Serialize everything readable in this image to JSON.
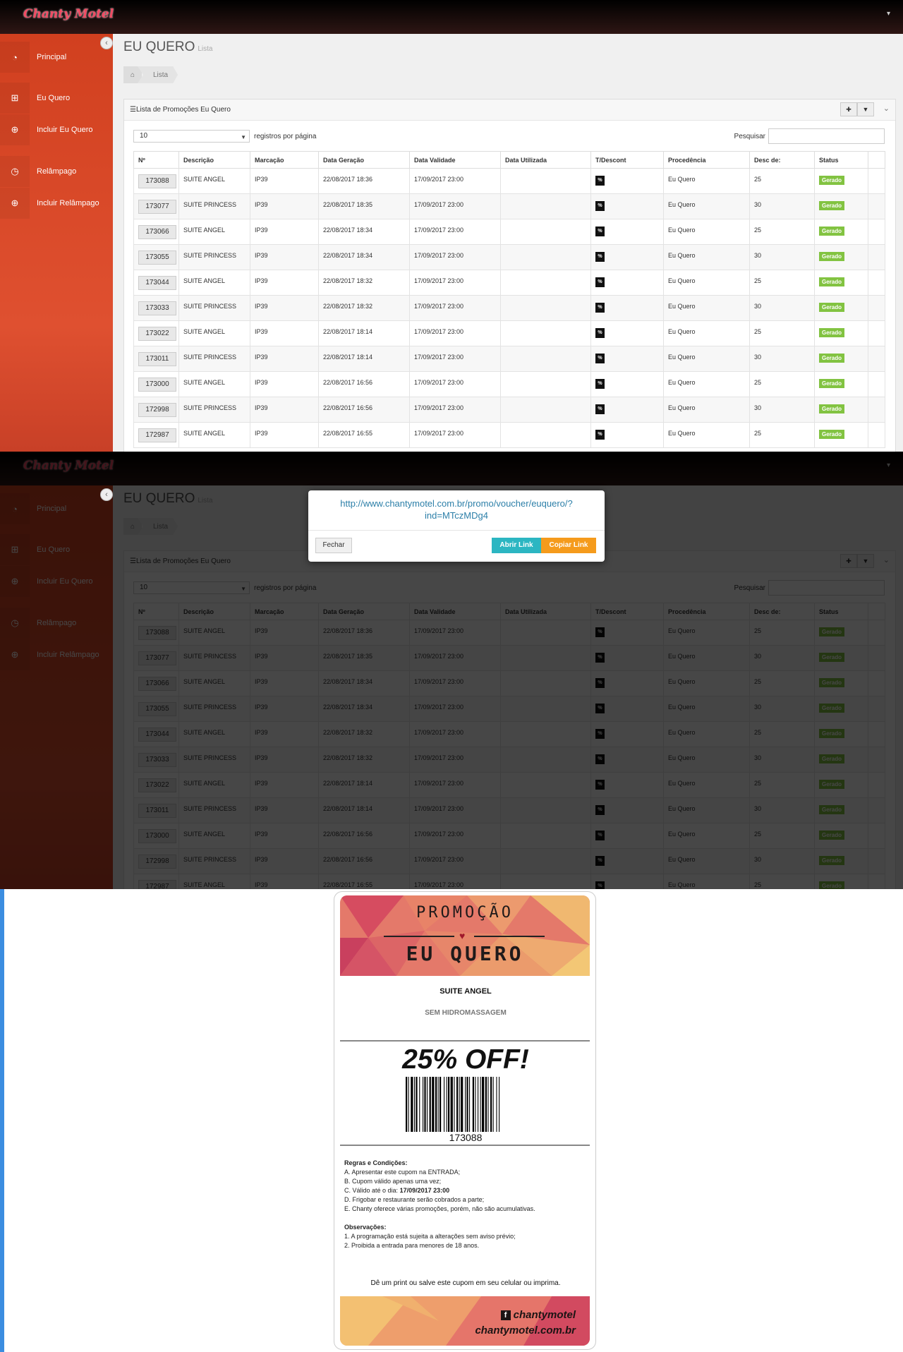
{
  "app": {
    "logo": "Chanty Motel",
    "page_title": "EU QUERO",
    "page_subtitle": "Lista",
    "breadcrumb": [
      "Lista"
    ],
    "sidebar": [
      {
        "label": "Principal",
        "icon": "dashboard-icon"
      },
      {
        "label": "Eu Quero",
        "icon": "gift-icon"
      },
      {
        "label": "Incluir Eu Quero",
        "icon": "plus-square-icon"
      },
      {
        "label": "Relâmpago",
        "icon": "clock-icon"
      },
      {
        "label": "Incluir Relâmpago",
        "icon": "plus-square-icon"
      }
    ],
    "panel_title": "Lista de Promoções Eu Quero",
    "length_value": "10",
    "length_label": "registros por página",
    "search_label": "Pesquisar",
    "columns": [
      "Nº",
      "Descrição",
      "Marcação",
      "Data Geração",
      "Data Validade",
      "Data Utilizada",
      "T/Descont",
      "Procedência",
      "Desc de:",
      "Status"
    ],
    "rows": [
      {
        "id": "173088",
        "desc": "SUITE ANGEL",
        "marc": "IP39",
        "gen": "22/08/2017 18:36",
        "val": "17/09/2017 23:00",
        "used": "",
        "tipo": "%",
        "proc": "Eu Quero",
        "pct": "25",
        "status": "Gerado"
      },
      {
        "id": "173077",
        "desc": "SUITE PRINCESS",
        "marc": "IP39",
        "gen": "22/08/2017 18:35",
        "val": "17/09/2017 23:00",
        "used": "",
        "tipo": "%",
        "proc": "Eu Quero",
        "pct": "30",
        "status": "Gerado"
      },
      {
        "id": "173066",
        "desc": "SUITE ANGEL",
        "marc": "IP39",
        "gen": "22/08/2017 18:34",
        "val": "17/09/2017 23:00",
        "used": "",
        "tipo": "%",
        "proc": "Eu Quero",
        "pct": "25",
        "status": "Gerado"
      },
      {
        "id": "173055",
        "desc": "SUITE PRINCESS",
        "marc": "IP39",
        "gen": "22/08/2017 18:34",
        "val": "17/09/2017 23:00",
        "used": "",
        "tipo": "%",
        "proc": "Eu Quero",
        "pct": "30",
        "status": "Gerado"
      },
      {
        "id": "173044",
        "desc": "SUITE ANGEL",
        "marc": "IP39",
        "gen": "22/08/2017 18:32",
        "val": "17/09/2017 23:00",
        "used": "",
        "tipo": "%",
        "proc": "Eu Quero",
        "pct": "25",
        "status": "Gerado"
      },
      {
        "id": "173033",
        "desc": "SUITE PRINCESS",
        "marc": "IP39",
        "gen": "22/08/2017 18:32",
        "val": "17/09/2017 23:00",
        "used": "",
        "tipo": "%",
        "proc": "Eu Quero",
        "pct": "30",
        "status": "Gerado"
      },
      {
        "id": "173022",
        "desc": "SUITE ANGEL",
        "marc": "IP39",
        "gen": "22/08/2017 18:14",
        "val": "17/09/2017 23:00",
        "used": "",
        "tipo": "%",
        "proc": "Eu Quero",
        "pct": "25",
        "status": "Gerado"
      },
      {
        "id": "173011",
        "desc": "SUITE PRINCESS",
        "marc": "IP39",
        "gen": "22/08/2017 18:14",
        "val": "17/09/2017 23:00",
        "used": "",
        "tipo": "%",
        "proc": "Eu Quero",
        "pct": "30",
        "status": "Gerado"
      },
      {
        "id": "173000",
        "desc": "SUITE ANGEL",
        "marc": "IP39",
        "gen": "22/08/2017 16:56",
        "val": "17/09/2017 23:00",
        "used": "",
        "tipo": "%",
        "proc": "Eu Quero",
        "pct": "25",
        "status": "Gerado"
      },
      {
        "id": "172998",
        "desc": "SUITE PRINCESS",
        "marc": "IP39",
        "gen": "22/08/2017 16:56",
        "val": "17/09/2017 23:00",
        "used": "",
        "tipo": "%",
        "proc": "Eu Quero",
        "pct": "30",
        "status": "Gerado"
      },
      {
        "id": "172987",
        "desc": "SUITE ANGEL",
        "marc": "IP39",
        "gen": "22/08/2017 16:55",
        "val": "17/09/2017 23:00",
        "used": "",
        "tipo": "%",
        "proc": "Eu Quero",
        "pct": "25",
        "status": "Gerado"
      }
    ]
  },
  "modal": {
    "url": "http://www.chantymotel.com.br/promo/voucher/euquero/?ind=MTczMDg4",
    "close_label": "Fechar",
    "open_label": "Abrir Link",
    "copy_label": "Copiar Link"
  },
  "coupon": {
    "promo_title": "PROMOÇÃO",
    "promo_subtitle": "EU QUERO",
    "suite": "SUITE ANGEL",
    "feature": "SEM HIDROMASSAGEM",
    "discount": "25% OFF!",
    "barcode_number": "173088",
    "rules_title": "Regras e Condições:",
    "rules": [
      "A. Apresentar este cupom na ENTRADA;",
      "B. Cupom válido apenas uma vez;",
      "C. Válido até o dia: ",
      "D. Frigobar e restaurante serão cobrados a parte;",
      "E. Chanty oferece várias promoções, porém, não são acumulativas."
    ],
    "valid_until": "17/09/2017 23:00",
    "obs_title": "Observações:",
    "obs": [
      "1. A programação está sujeita a alterações sem aviso prévio;",
      "2. Proibida a entrada para menores de 18 anos."
    ],
    "print_note": "Dê um print ou salve este cupom em seu celular ou imprima.",
    "facebook": "chantymotel",
    "site": "chantymotel.com.br"
  }
}
